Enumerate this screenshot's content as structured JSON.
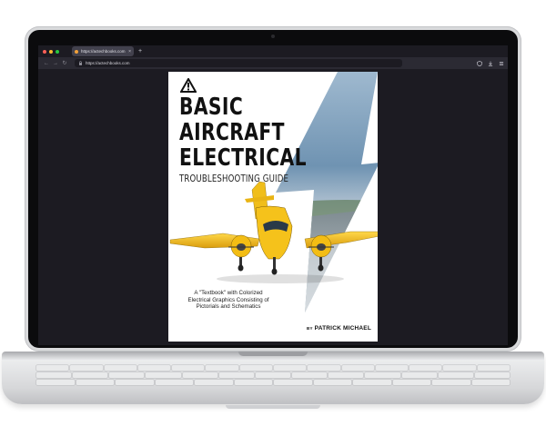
{
  "colors": {
    "lid": "#d9dadc",
    "bezel": "#0b0b0d",
    "browser_bg": "#1c1b22",
    "toolbar": "#2b2a33",
    "accent_yellow": "#f5c21b",
    "sky_blue": "#5d87a8"
  },
  "browser": {
    "window_controls": [
      "close",
      "minimize",
      "zoom"
    ],
    "tab": {
      "title": "https://actechbooks.com",
      "close_glyph": "×",
      "favicon": "favicon-icon"
    },
    "new_tab_glyph": "+",
    "nav": {
      "back_glyph": "←",
      "forward_glyph": "→",
      "reload_glyph": "↻",
      "url": "https://actechbooks.com",
      "icons": [
        "lock-icon",
        "shield-icon",
        "download-icon",
        "menu-icon"
      ]
    }
  },
  "cover": {
    "title_lines": [
      "BASIC",
      "AIRCRAFT",
      "ELECTRICAL"
    ],
    "subtitle": "TROUBLESHOOTING GUIDE",
    "tagline": "A \"Textbook\" with Colorized Electrical Graphics Consisting of Pictorials and Schematics",
    "author_prefix": "BY",
    "author_name": "PATRICK MICHAEL",
    "icons": [
      "warning-icon",
      "lightning-bolt-graphic",
      "airplane-graphic"
    ]
  }
}
